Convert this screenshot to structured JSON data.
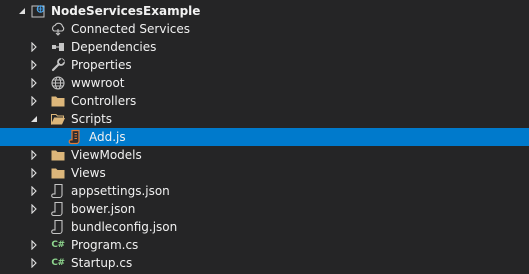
{
  "solution_explorer": {
    "project": {
      "label": "NodeServicesExample",
      "expanded": true,
      "icon": "csharp-web-project-icon"
    },
    "items": [
      {
        "label": "Connected Services",
        "icon": "connected-services-icon",
        "expander": "none"
      },
      {
        "label": "Dependencies",
        "icon": "dependencies-icon",
        "expander": "collapsed"
      },
      {
        "label": "Properties",
        "icon": "wrench-icon",
        "expander": "collapsed"
      },
      {
        "label": "wwwroot",
        "icon": "globe-icon",
        "expander": "collapsed"
      },
      {
        "label": "Controllers",
        "icon": "folder-icon",
        "expander": "collapsed"
      },
      {
        "label": "Scripts",
        "icon": "folder-open-icon",
        "expander": "expanded"
      },
      {
        "label": "Add.js",
        "icon": "js-file-icon",
        "expander": "none",
        "selected": true
      },
      {
        "label": "ViewModels",
        "icon": "folder-icon",
        "expander": "collapsed"
      },
      {
        "label": "Views",
        "icon": "folder-icon",
        "expander": "collapsed"
      },
      {
        "label": "appsettings.json",
        "icon": "json-file-icon",
        "expander": "collapsed"
      },
      {
        "label": "bower.json",
        "icon": "json-file-icon",
        "expander": "collapsed"
      },
      {
        "label": "bundleconfig.json",
        "icon": "json-file-icon",
        "expander": "none"
      },
      {
        "label": "Program.cs",
        "icon": "csharp-file-icon",
        "expander": "collapsed"
      },
      {
        "label": "Startup.cs",
        "icon": "csharp-file-icon",
        "expander": "collapsed"
      }
    ],
    "colors": {
      "background": "#252526",
      "selection": "#007acc",
      "text": "#f1f1f1",
      "folder": "#dcb67a",
      "csharp": "#8ed68e",
      "js": "#e37933"
    }
  }
}
